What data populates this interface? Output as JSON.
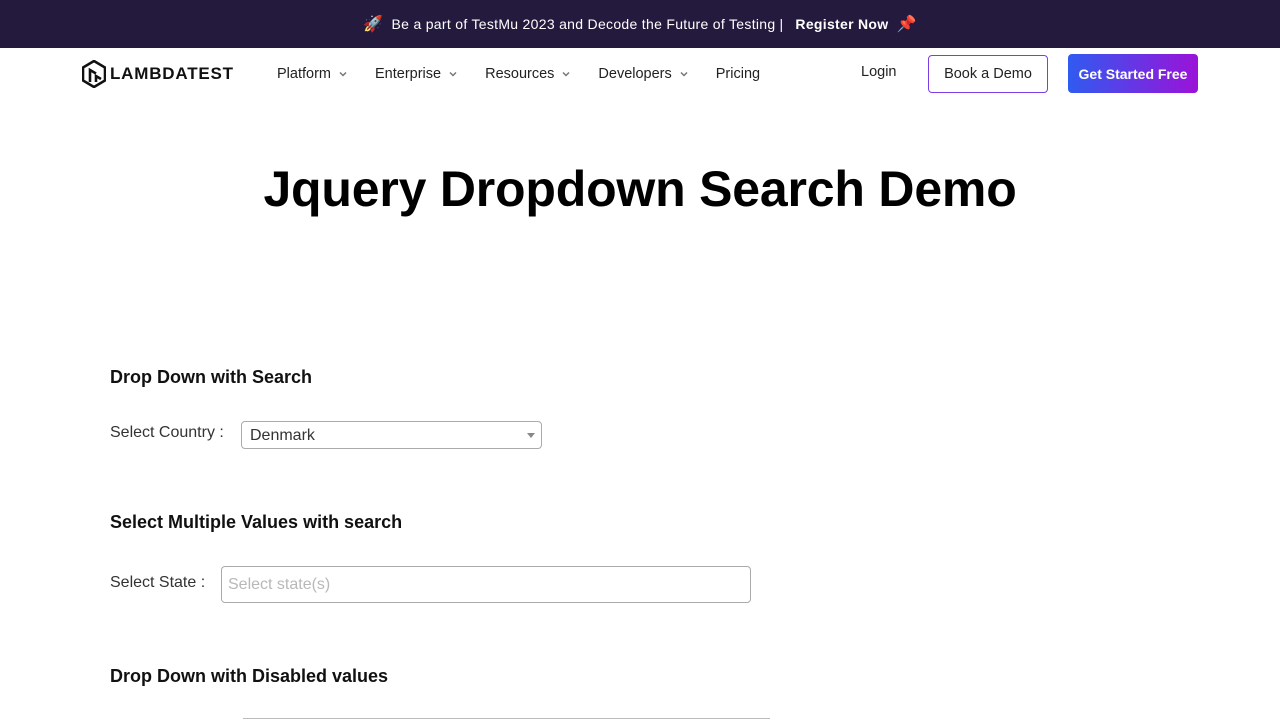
{
  "announcement": {
    "rocket": "🚀",
    "text": "Be a part of TestMu 2023 and Decode the Future of Testing",
    "separator": "|",
    "register_label": "Register Now",
    "pin": "📌",
    "bg_color": "#231a3d"
  },
  "nav": {
    "logo_text": "LAMBDATEST",
    "items": [
      {
        "label": "Platform",
        "has_dropdown": true
      },
      {
        "label": "Enterprise",
        "has_dropdown": true
      },
      {
        "label": "Resources",
        "has_dropdown": true
      },
      {
        "label": "Developers",
        "has_dropdown": true
      },
      {
        "label": "Pricing",
        "has_dropdown": false
      }
    ],
    "login_label": "Login",
    "book_demo_label": "Book a Demo",
    "get_started_label": "Get Started Free"
  },
  "page": {
    "title": "Jquery Dropdown Search Demo"
  },
  "sections": {
    "single": {
      "heading": "Drop Down with Search",
      "label": "Select Country :",
      "selected_value": "Denmark"
    },
    "multiple": {
      "heading": "Select Multiple Values with search",
      "label": "Select State :",
      "placeholder": "Select state(s)"
    },
    "disabled": {
      "heading": "Drop Down with Disabled values"
    }
  },
  "colors": {
    "accent_gradient_start": "#2f5bf0",
    "accent_gradient_end": "#9b12d8"
  }
}
